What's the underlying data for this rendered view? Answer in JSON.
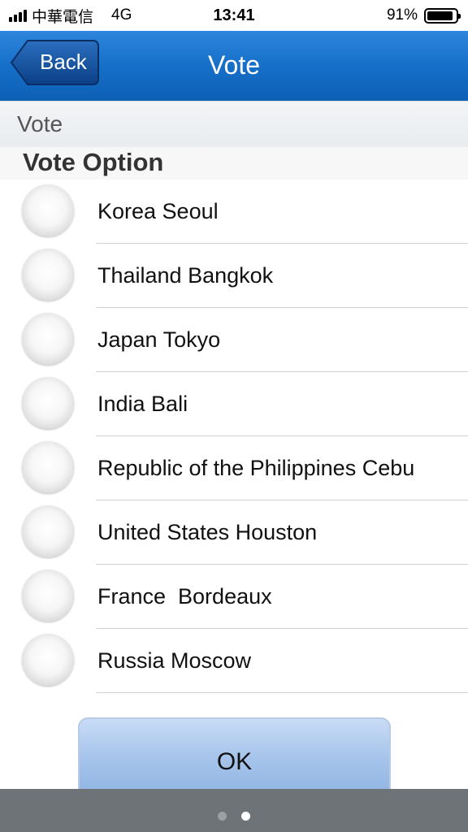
{
  "status_bar": {
    "carrier": "中華電信",
    "network": "4G",
    "time": "13:41",
    "battery": "91%",
    "battery_level": 0.91
  },
  "nav": {
    "back_label": "Back",
    "title": "Vote"
  },
  "section": {
    "title": "Vote"
  },
  "group": {
    "title": "Vote Option"
  },
  "options": [
    {
      "label": "Korea Seoul",
      "selected": false
    },
    {
      "label": "Thailand Bangkok",
      "selected": false
    },
    {
      "label": "Japan Tokyo",
      "selected": false
    },
    {
      "label": "India Bali",
      "selected": false
    },
    {
      "label": "Republic of the Philippines Cebu",
      "selected": false
    },
    {
      "label": "United States Houston",
      "selected": false
    },
    {
      "label": "France  Bordeaux",
      "selected": false
    },
    {
      "label": "Russia Moscow",
      "selected": false
    }
  ],
  "ok_label": "OK",
  "pager": {
    "page_count": 2,
    "current_page": 2
  },
  "colors": {
    "nav_bar": "#1670c8",
    "ok_button": "#a9c6ec",
    "page_bar": "#6e7378"
  }
}
